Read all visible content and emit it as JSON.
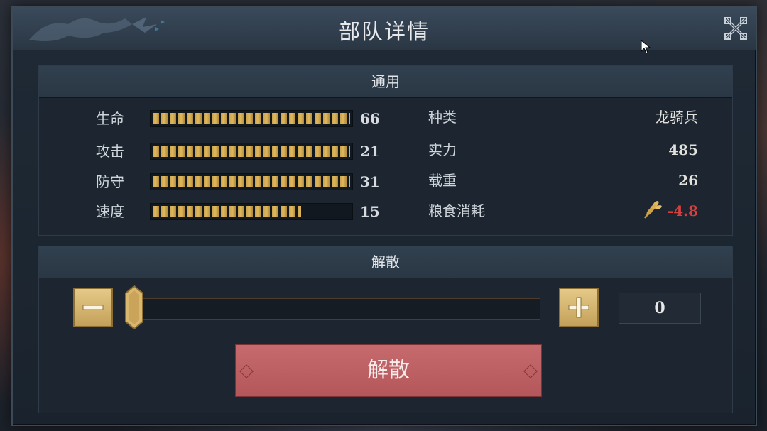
{
  "window": {
    "title": "部队详情",
    "close_icon": "close-x-icon"
  },
  "general": {
    "header": "通用",
    "stats": [
      {
        "label": "生命",
        "value": "66",
        "fill": 1.0
      },
      {
        "label": "攻击",
        "value": "21",
        "fill": 1.0
      },
      {
        "label": "防守",
        "value": "31",
        "fill": 1.0
      },
      {
        "label": "速度",
        "value": "15",
        "fill": 0.75
      }
    ],
    "info": [
      {
        "label": "种类",
        "value": "龙骑兵"
      },
      {
        "label": "实力",
        "value": "485"
      },
      {
        "label": "载重",
        "value": "26"
      },
      {
        "label": "粮食消耗",
        "value": "-4.8",
        "icon": "wheat-icon"
      }
    ]
  },
  "disband": {
    "header": "解散",
    "quantity": "0",
    "slider_value": 0,
    "minus_icon": "minus-icon",
    "plus_icon": "plus-icon",
    "button_label": "解散"
  },
  "colors": {
    "accent_gold": "#e0b95e",
    "negative_red": "#d6403e",
    "disband_button": "#c76a6d"
  }
}
